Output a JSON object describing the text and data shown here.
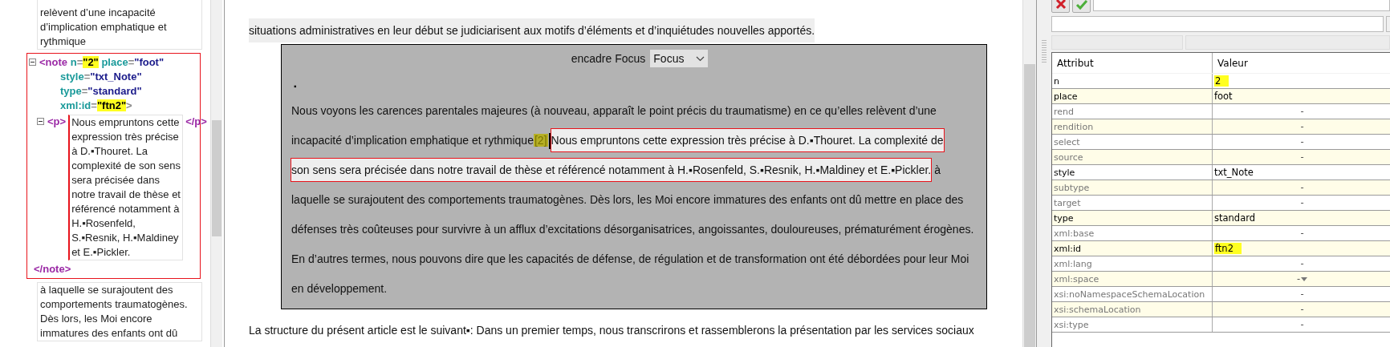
{
  "tree_panel": {
    "text_before": "relèvent d’une incapacité d’implication emphatique et rythmique",
    "note": {
      "expanded": true,
      "open_tag": "<note",
      "open_end": ">",
      "close_tag": "</note>",
      "attributes": [
        {
          "name": "n",
          "equals": "=",
          "value": "\"2\"",
          "highlighted": true
        },
        {
          "name": "place",
          "equals": "=",
          "value": "\"foot\"",
          "highlighted": false
        },
        {
          "name": "style",
          "equals": "=",
          "value": "\"txt_Note\"",
          "highlighted": false
        },
        {
          "name": "type",
          "equals": "=",
          "value": "\"standard\"",
          "highlighted": false
        },
        {
          "name": "xml:id",
          "equals": "=",
          "value": "\"ftn2\"",
          "highlighted": true
        }
      ],
      "child": {
        "expanded": true,
        "open_tag": "<p>",
        "close_tag": "</p>",
        "text": "Nous empruntons cette expression très précise à D.▪Thouret. La complexité de son sens sera précisée dans notre travail de thèse et référencé notamment à H.▪Rosenfeld, S.▪Resnik, H.▪Maldiney et E.▪Pickler."
      }
    },
    "text_after": " à laquelle se surajoutent des comportements traumatogènes. Dès lors, les Moi encore immatures des enfants ont dû"
  },
  "document": {
    "paragraph_before": "situations administratives en leur début se judiciarisent aux motifs d’éléments et d’inquiétudes nouvelles apportés.",
    "encadre": {
      "label": "encadre Focus",
      "select_value": "Focus",
      "bullet": "▪",
      "text_before": "Nous voyons les carences parentales majeures (à nouveau, apparaît le point précis du traumatisme) en ce qu’elles relèvent d’une incapacité d’implication emphatique et rythmique",
      "note_ref": "[2]",
      "note_text_lines": [
        "Nous empruntons cette expression très précise à D.▪Thouret. La complexité de",
        "son sens sera précisée dans notre travail de thèse et référencé notamment à H.▪Rosenfeld, S.▪Resnik, H.▪Maldiney et E.▪Pickler."
      ],
      "text_after": " à laquelle se surajoutent des comportements traumatogènes. Dès lors, les Moi encore immatures des enfants ont dû mettre en place des défenses très coûteuses pour survivre à un afflux d’excitations désorganisatrices, angoissantes, douloureuses, prématurément érogènes. En d’autres termes, nous pouvons dire que les capacités de défense, de régulation et de transformation ont été débordées pour leur Moi en développement."
    },
    "paragraph_after": "La structure du présent article est le suivant▪: Dans un premier temps, nous transcrirons et rassemblerons la présentation par les services sociaux"
  },
  "attributes_panel": {
    "columns": [
      "Attribut",
      "Valeur"
    ],
    "rows": [
      {
        "name": "n",
        "value": "2",
        "defined": true,
        "highlighted": true,
        "kind": "text"
      },
      {
        "name": "place",
        "value": "foot",
        "defined": true,
        "highlighted": false,
        "kind": "text"
      },
      {
        "name": "rend",
        "value": "-",
        "defined": false,
        "highlighted": false,
        "kind": "text"
      },
      {
        "name": "rendition",
        "value": "-",
        "defined": false,
        "highlighted": false,
        "kind": "text"
      },
      {
        "name": "select",
        "value": "-",
        "defined": false,
        "highlighted": false,
        "kind": "text"
      },
      {
        "name": "source",
        "value": "-",
        "defined": false,
        "highlighted": false,
        "kind": "text"
      },
      {
        "name": "style",
        "value": "txt_Note",
        "defined": true,
        "highlighted": false,
        "kind": "text"
      },
      {
        "name": "subtype",
        "value": "-",
        "defined": false,
        "highlighted": false,
        "kind": "text"
      },
      {
        "name": "target",
        "value": "-",
        "defined": false,
        "highlighted": false,
        "kind": "text"
      },
      {
        "name": "type",
        "value": "standard",
        "defined": true,
        "highlighted": false,
        "kind": "text"
      },
      {
        "name": "xml:base",
        "value": "-",
        "defined": false,
        "highlighted": false,
        "kind": "text"
      },
      {
        "name": "xml:id",
        "value": "ftn2",
        "defined": true,
        "highlighted": true,
        "kind": "text"
      },
      {
        "name": "xml:lang",
        "value": "-",
        "defined": false,
        "highlighted": false,
        "kind": "text"
      },
      {
        "name": "xml:space",
        "value": "-",
        "defined": false,
        "highlighted": false,
        "kind": "dropdown"
      },
      {
        "name": "xsi:noNamespaceSchemaLocation",
        "value": "-",
        "defined": false,
        "highlighted": false,
        "kind": "text"
      },
      {
        "name": "xsi:schemaLocation",
        "value": "-",
        "defined": false,
        "highlighted": false,
        "kind": "text"
      },
      {
        "name": "xsi:type",
        "value": "-",
        "defined": false,
        "highlighted": false,
        "kind": "text"
      }
    ]
  }
}
